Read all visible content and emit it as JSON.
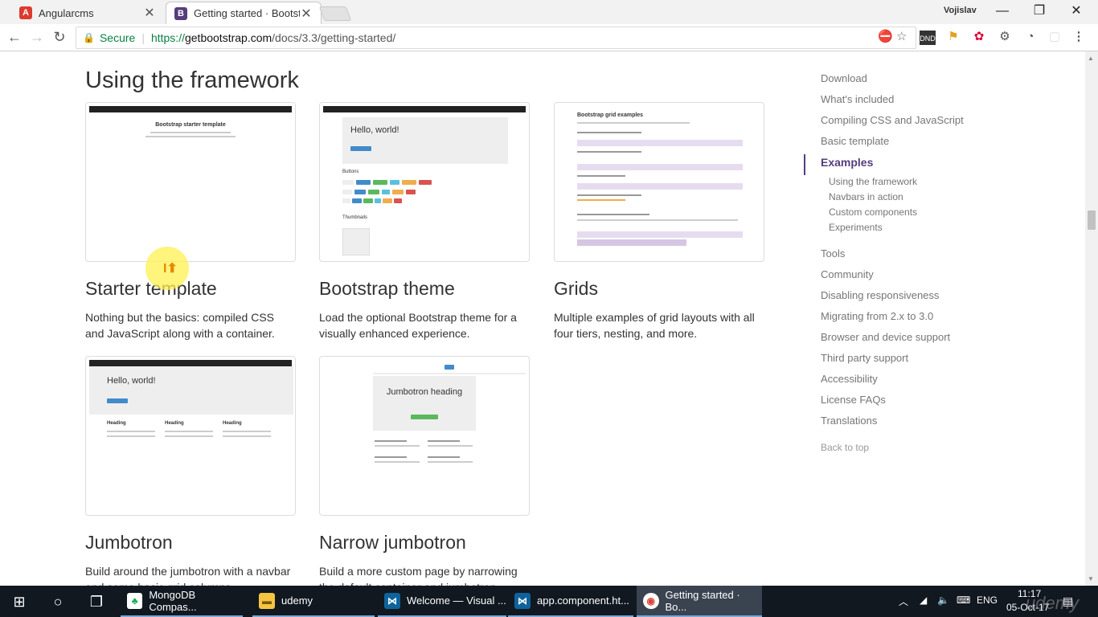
{
  "tabs": [
    {
      "title": "Angularcms",
      "favicon": "A",
      "color": "#dd3b2f"
    },
    {
      "title": "Getting started · Bootstrap",
      "favicon": "B",
      "color": "#563d7c"
    }
  ],
  "profile_name": "Vojislav",
  "toolbar": {
    "secure_label": "Secure",
    "url_scheme": "https://",
    "url_host": "getbootstrap.com",
    "url_path": "/docs/3.3/getting-started/"
  },
  "page": {
    "section_title": "Using the framework",
    "cards": [
      {
        "title": "Starter template",
        "desc": "Nothing but the basics: compiled CSS and JavaScript along with a container."
      },
      {
        "title": "Bootstrap theme",
        "desc": "Load the optional Bootstrap theme for a visually enhanced experience."
      },
      {
        "title": "Grids",
        "desc": "Multiple examples of grid layouts with all four tiers, nesting, and more."
      },
      {
        "title": "Jumbotron",
        "desc": "Build around the jumbotron with a navbar and some basic grid columns."
      },
      {
        "title": "Narrow jumbotron",
        "desc": "Build a more custom page by narrowing the default container and jumbotron."
      }
    ],
    "thumbs": {
      "starter_heading": "Bootstrap starter template",
      "theme_hello": "Hello, world!",
      "theme_buttons": "Buttons",
      "theme_thumbnails": "Thumbnails",
      "grids_heading": "Bootstrap grid examples",
      "jumbo_hello": "Hello, world!",
      "jumbo_heading": "Heading",
      "narrow_heading": "Jumbotron heading"
    }
  },
  "sidebar": {
    "items": [
      "Download",
      "What's included",
      "Compiling CSS and JavaScript",
      "Basic template"
    ],
    "active": "Examples",
    "subitems": [
      "Using the framework",
      "Navbars in action",
      "Custom components",
      "Experiments"
    ],
    "items_after": [
      "Tools",
      "Community",
      "Disabling responsiveness",
      "Migrating from 2.x to 3.0",
      "Browser and device support",
      "Third party support",
      "Accessibility",
      "License FAQs",
      "Translations"
    ],
    "back_to_top": "Back to top"
  },
  "taskbar": {
    "apps": [
      {
        "label": "MongoDB Compas...",
        "icon": "leaf-icon"
      },
      {
        "label": "udemy",
        "icon": "folder-icon"
      },
      {
        "label": "Welcome — Visual ...",
        "icon": "vscode-icon"
      },
      {
        "label": "app.component.ht...",
        "icon": "vscode-icon"
      },
      {
        "label": "Getting started · Bo...",
        "icon": "chrome-icon"
      }
    ],
    "lang": "ENG",
    "time": "11:17",
    "date": "05-Oct-17"
  },
  "watermark": "udemy"
}
